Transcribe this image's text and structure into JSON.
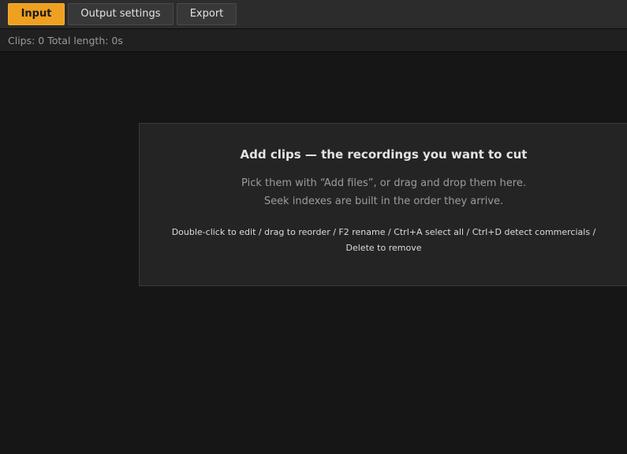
{
  "tabs": {
    "input": "Input",
    "output": "Output settings",
    "export": "Export"
  },
  "status": {
    "text": "Clips: 0 Total length: 0s"
  },
  "empty_state": {
    "title": "Add clips — the recordings you want to cut",
    "line1": "Pick them with “Add files”, or drag and drop them here.",
    "line2": "Seek indexes are built in the order they arrive.",
    "hint1": "Double-click to edit / drag to reorder / F2 rename / Ctrl+A select all / Ctrl+D detect commercials /",
    "hint2": "Delete to remove"
  },
  "colors": {
    "accent": "#f0a020",
    "background": "#161616",
    "toolbar": "#2c2c2c",
    "panel": "#242424"
  }
}
